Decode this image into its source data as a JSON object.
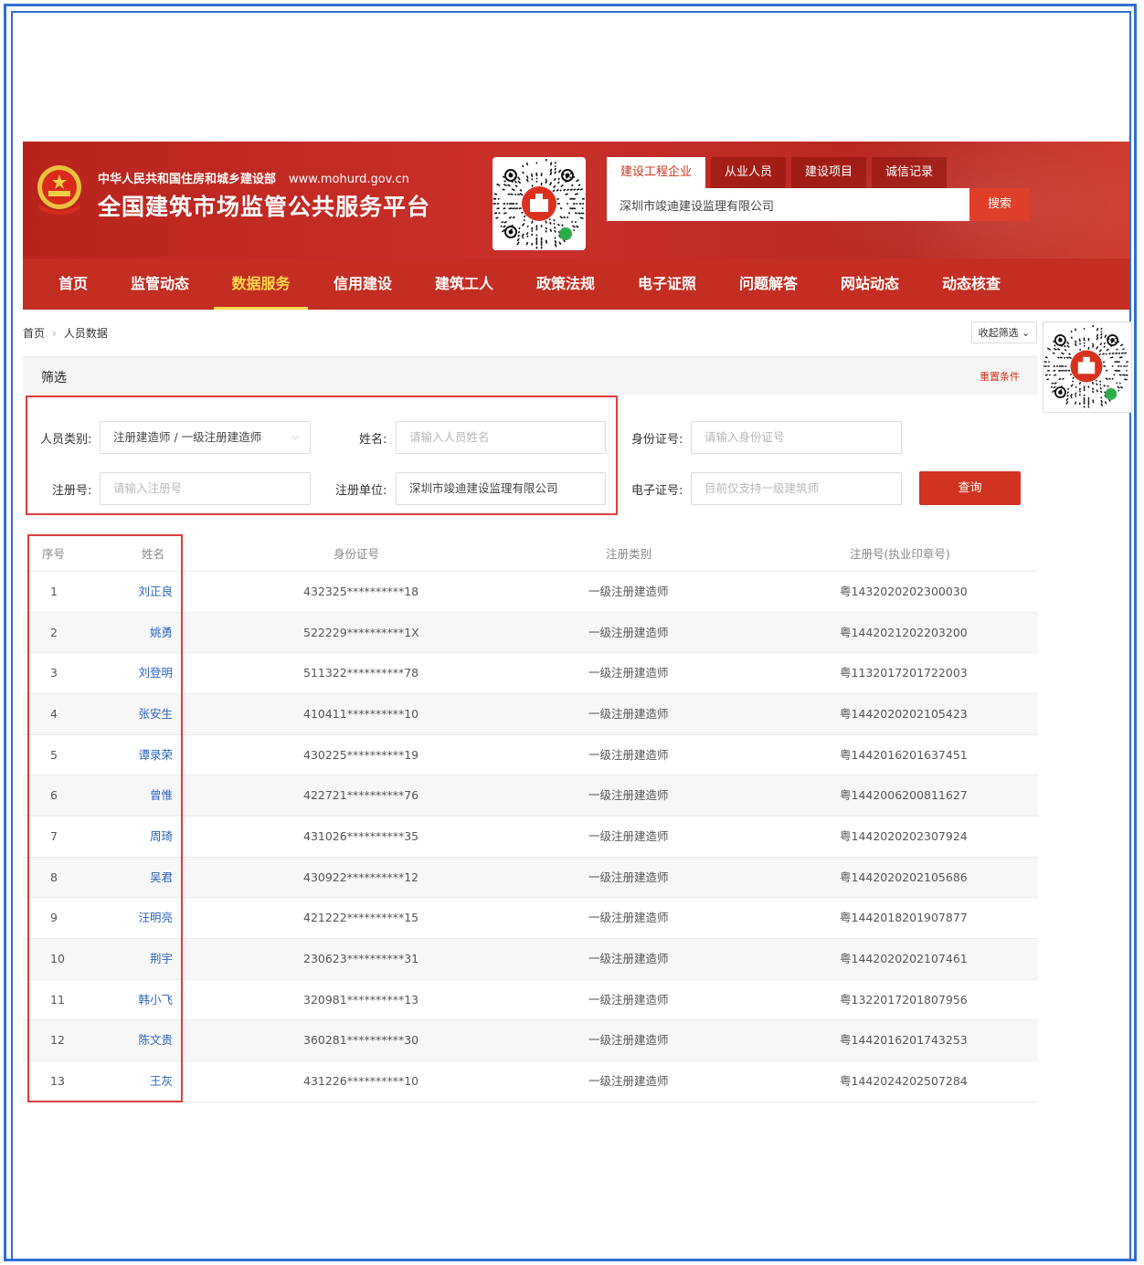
{
  "header": {
    "ministry": "中华人民共和国住房和城乡建设部",
    "url": "www.mohurd.gov.cn",
    "platform_title": "全国建筑市场监管公共服务平台",
    "search_tabs": [
      "建设工程企业",
      "从业人员",
      "建设项目",
      "诚信记录"
    ],
    "active_search_tab": "建设工程企业",
    "search_value": "深圳市竣迪建设监理有限公司",
    "search_button": "搜索"
  },
  "nav": {
    "items": [
      "首页",
      "监管动态",
      "数据服务",
      "信用建设",
      "建筑工人",
      "政策法规",
      "电子证照",
      "问题解答",
      "网站动态",
      "动态核查"
    ],
    "active": "数据服务"
  },
  "breadcrumb": {
    "home": "首页",
    "current": "人员数据",
    "collapse_button": "收起筛选"
  },
  "filter": {
    "title": "筛选",
    "reset": "重置条件",
    "person_type_label": "人员类别:",
    "person_type_value": "注册建造师 / 一级注册建造师",
    "name_label": "姓名:",
    "name_placeholder": "请输入人员姓名",
    "id_label": "身份证号:",
    "id_placeholder": "请输入身份证号",
    "reg_no_label": "注册号:",
    "reg_no_placeholder": "请输入注册号",
    "reg_unit_label": "注册单位:",
    "reg_unit_value": "深圳市竣迪建设监理有限公司",
    "cert_label": "电子证号:",
    "cert_placeholder": "目前仅支持一级建筑师",
    "query_button": "查询"
  },
  "table": {
    "columns": [
      "序号",
      "姓名",
      "身份证号",
      "注册类别",
      "注册号(执业印章号)"
    ],
    "rows": [
      {
        "no": "1",
        "name": "刘正良",
        "id": "432325**********18",
        "type": "一级注册建造师",
        "reg": "粤1432020202300030"
      },
      {
        "no": "2",
        "name": "姚勇",
        "id": "522229**********1X",
        "type": "一级注册建造师",
        "reg": "粤1442021202203200"
      },
      {
        "no": "3",
        "name": "刘登明",
        "id": "511322**********78",
        "type": "一级注册建造师",
        "reg": "粤1132017201722003"
      },
      {
        "no": "4",
        "name": "张安生",
        "id": "410411**********10",
        "type": "一级注册建造师",
        "reg": "粤1442020202105423"
      },
      {
        "no": "5",
        "name": "谭录荣",
        "id": "430225**********19",
        "type": "一级注册建造师",
        "reg": "粤1442016201637451"
      },
      {
        "no": "6",
        "name": "曾惟",
        "id": "422721**********76",
        "type": "一级注册建造师",
        "reg": "粤1442006200811627"
      },
      {
        "no": "7",
        "name": "周琦",
        "id": "431026**********35",
        "type": "一级注册建造师",
        "reg": "粤1442020202307924"
      },
      {
        "no": "8",
        "name": "吴君",
        "id": "430922**********12",
        "type": "一级注册建造师",
        "reg": "粤1442020202105686"
      },
      {
        "no": "9",
        "name": "汪明亮",
        "id": "421222**********15",
        "type": "一级注册建造师",
        "reg": "粤1442018201907877"
      },
      {
        "no": "10",
        "name": "荆宇",
        "id": "230623**********31",
        "type": "一级注册建造师",
        "reg": "粤1442020202107461"
      },
      {
        "no": "11",
        "name": "韩小飞",
        "id": "320981**********13",
        "type": "一级注册建造师",
        "reg": "粤1322017201807956"
      },
      {
        "no": "12",
        "name": "陈文贵",
        "id": "360281**********30",
        "type": "一级注册建造师",
        "reg": "粤1442016201743253"
      },
      {
        "no": "13",
        "name": "王灰",
        "id": "431226**********10",
        "type": "一级注册建造师",
        "reg": "粤1442024202507284"
      }
    ]
  },
  "colors": {
    "brand_red": "#c42d22",
    "active_nav": "#ffd84a",
    "annotation_box": "#e03c3c",
    "frame_blue": "#2f6fd1",
    "link_blue": "#2a63b8"
  }
}
